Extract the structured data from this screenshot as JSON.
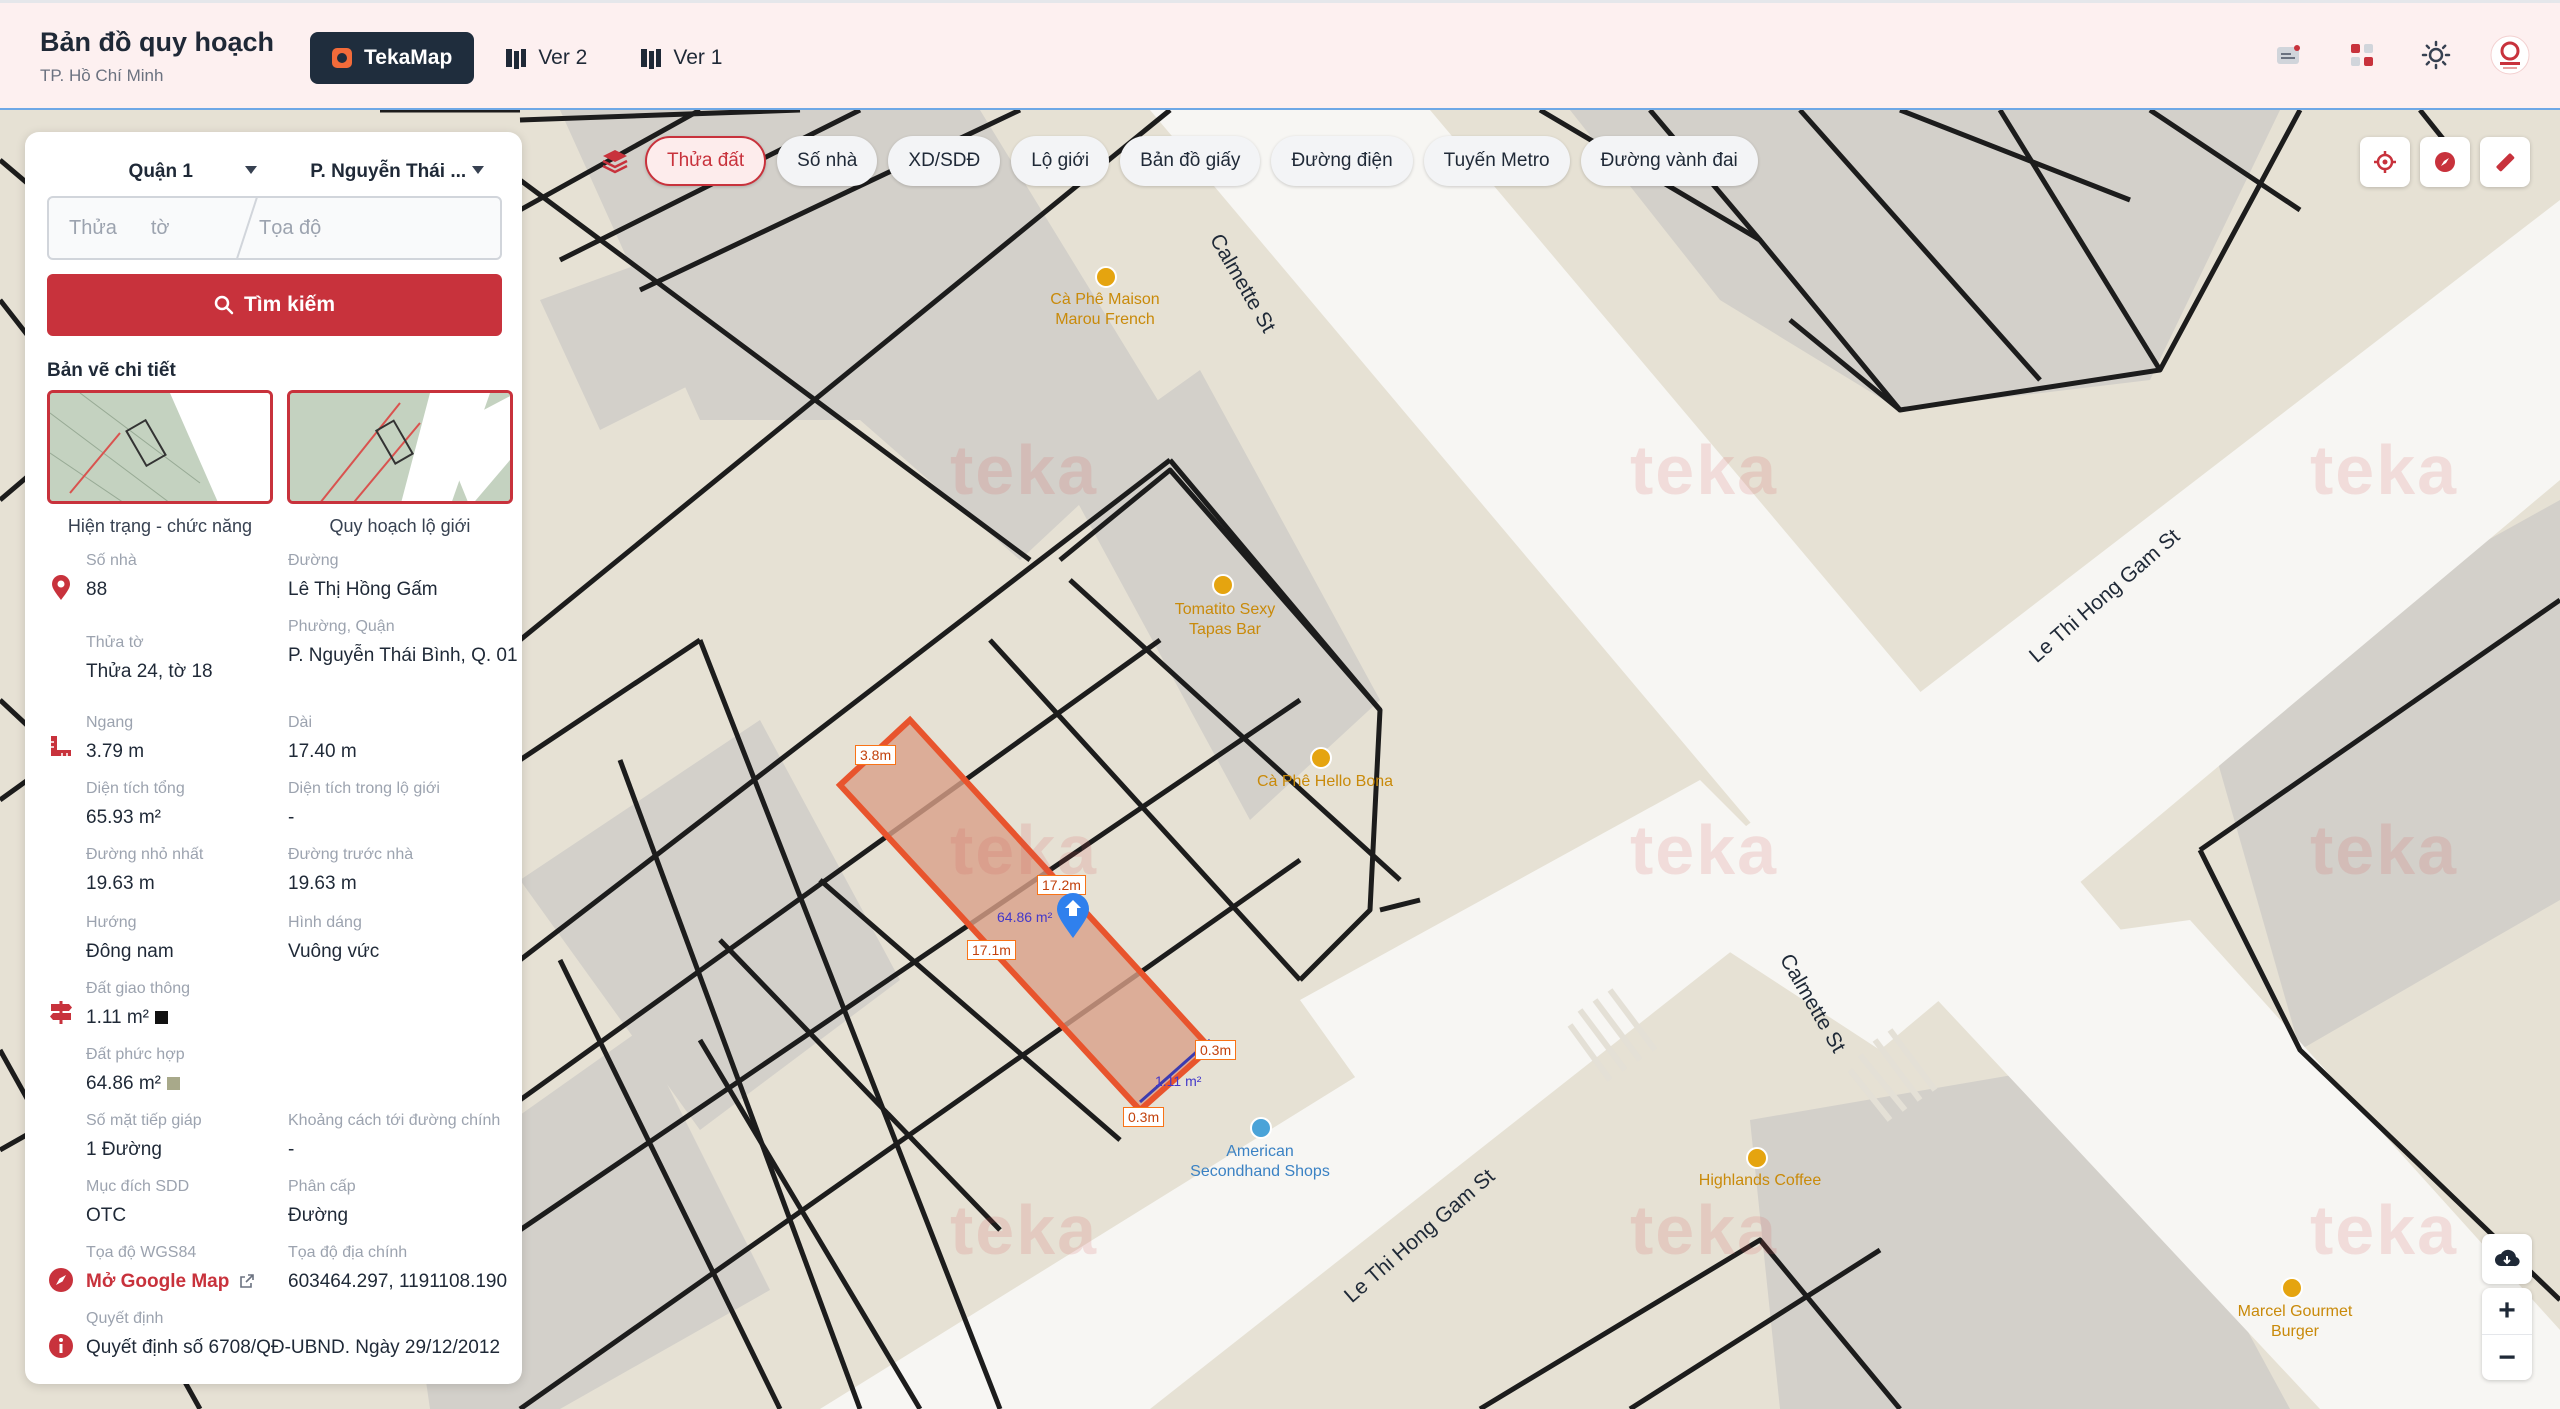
{
  "header": {
    "title": "Bản đồ quy hoạch",
    "subtitle": "TP. Hồ Chí Minh",
    "tabs": [
      {
        "label": "TekaMap",
        "active": true
      },
      {
        "label": "Ver 2",
        "active": false
      },
      {
        "label": "Ver 1",
        "active": false
      }
    ],
    "icons": [
      "notes-icon",
      "grid-apps-icon",
      "sun-theme-icon",
      "saigon-logo-icon"
    ]
  },
  "layers": {
    "chips": [
      {
        "label": "Thửa đất",
        "active": true
      },
      {
        "label": "Số nhà",
        "active": false
      },
      {
        "label": "XD/SDĐ",
        "active": false
      },
      {
        "label": "Lộ giới",
        "active": false
      },
      {
        "label": "Bản đồ giấy",
        "active": false
      },
      {
        "label": "Đường điện",
        "active": false
      },
      {
        "label": "Tuyến Metro",
        "active": false
      },
      {
        "label": "Đường vành đai",
        "active": false
      }
    ]
  },
  "search": {
    "district": "Quận 1",
    "ward": "P. Nguyễn Thái ...",
    "parcel_placeholder": "Thửa",
    "sheet_placeholder": "tờ",
    "coord_placeholder": "Tọa độ",
    "button": "Tìm kiếm"
  },
  "drawings": {
    "title": "Bản vẽ chi tiết",
    "items": [
      {
        "caption": "Hiện trạng - chức năng"
      },
      {
        "caption": "Quy hoạch lộ giới"
      }
    ]
  },
  "info": {
    "so_nha": {
      "label": "Số nhà",
      "value": "88"
    },
    "duong": {
      "label": "Đường",
      "value": "Lê Thị Hồng Gấm"
    },
    "phuong": {
      "label": "Phường, Quận",
      "value": "P. Nguyễn Thái Bình, Q. 01"
    },
    "thua_to": {
      "label": "Thửa tờ",
      "value": "Thửa 24, tờ 18"
    },
    "ngang": {
      "label": "Ngang",
      "value": "3.79 m"
    },
    "dai": {
      "label": "Dài",
      "value": "17.40 m"
    },
    "dt_tong": {
      "label": "Diện tích tổng",
      "value": "65.93 m²"
    },
    "dt_lo_gioi": {
      "label": "Diện tích trong lộ giới",
      "value": "-"
    },
    "duong_nho": {
      "label": "Đường nhỏ nhất",
      "value": "19.63 m"
    },
    "duong_truoc": {
      "label": "Đường trước nhà",
      "value": "19.63 m"
    },
    "huong": {
      "label": "Hướng",
      "value": "Đông nam"
    },
    "hinh_dang": {
      "label": "Hình dáng",
      "value": "Vuông vức"
    },
    "dat_gt": {
      "label": "Đất giao thông",
      "value": "1.11 m²",
      "color": "#111111"
    },
    "dat_ph": {
      "label": "Đất phức hợp",
      "value": "64.86 m²",
      "color": "#a8a98a"
    },
    "so_mat": {
      "label": "Số mặt tiếp giáp",
      "value": "1 Đường"
    },
    "khoang_cach": {
      "label": "Khoảng cách tới đường chính",
      "value": "-"
    },
    "muc_dich": {
      "label": "Mục đích SDD",
      "value": "OTC"
    },
    "phan_cap": {
      "label": "Phân cấp",
      "value": "Đường"
    },
    "wgs84": {
      "label": "Tọa độ WGS84",
      "value": "Mở Google Map"
    },
    "dia_chinh": {
      "label": "Tọa độ địa chính",
      "value": "603464.297, 1191108.190"
    },
    "quyet_dinh": {
      "label": "Quyết định",
      "value": "Quyết định số 6708/QĐ-UBND. Ngày 29/12/2012"
    }
  },
  "map": {
    "streets": [
      "Calmette St",
      "Le Thi Hong Gam St",
      "Calmette St",
      "Le Thi Hong Gam St"
    ],
    "pois": [
      {
        "name": "Cà Phê Maison Marou French",
        "lines": [
          "Cà Phê Maison",
          "Marou French"
        ]
      },
      {
        "name": "Tomatito Sexy Tapas Bar",
        "lines": [
          "Tomatito Sexy",
          "Tapas Bar"
        ]
      },
      {
        "name": "Cà Phê Hello Bona",
        "lines": [
          "Cà Phê Hello Bona"
        ]
      },
      {
        "name": "American Secondhand Shops",
        "lines": [
          "American",
          "Secondhand Shops"
        ]
      },
      {
        "name": "Highlands Coffee",
        "lines": [
          "Highlands Coffee"
        ]
      },
      {
        "name": "Marcel Gourmet Burger",
        "lines": [
          "Marcel Gourmet",
          "Burger"
        ]
      }
    ],
    "parcel": {
      "dims": [
        "3.8m",
        "17.2m",
        "17.1m",
        "0.3m",
        "0.3m"
      ],
      "area": "64.86 m²",
      "road_area": "1.11 m²",
      "fill": "#d9a088",
      "stroke": "#e8542d"
    },
    "watermark": "teka"
  }
}
